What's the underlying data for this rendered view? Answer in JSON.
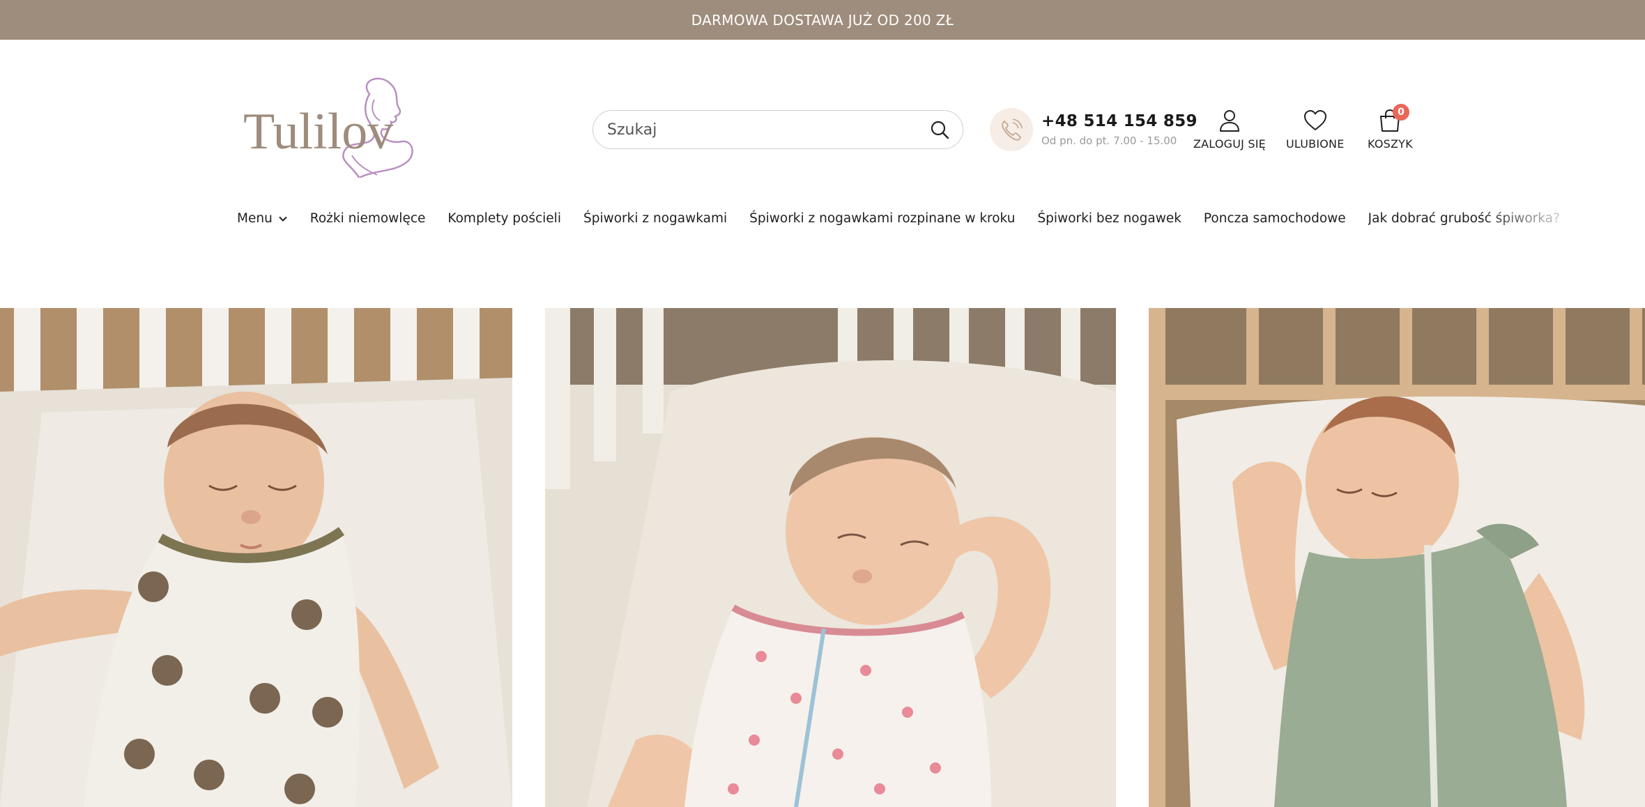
{
  "promo": {
    "text": "DARMOWA DOSTAWA JUŻ OD 200 ZŁ"
  },
  "brand": {
    "name": "Tulilov",
    "logo_color": "#9e8c7c",
    "accent_color": "#b98fc1"
  },
  "search": {
    "placeholder": "Szukaj",
    "value": ""
  },
  "contact": {
    "phone": "+48 514 154 859",
    "hours": "Od pn. do pt. 7.00 - 15.00"
  },
  "actions": {
    "login_label": "ZALOGUJ SIĘ",
    "favorites_label": "ULUBIONE",
    "cart_label": "KOSZYK",
    "cart_count": "0"
  },
  "nav": {
    "items": [
      {
        "label": "Menu"
      },
      {
        "label": "Rożki niemowlęce"
      },
      {
        "label": "Komplety pościeli"
      },
      {
        "label": "Śpiworki z nogawkami"
      },
      {
        "label": "Śpiworki z nogawkami rozpinane w kroku"
      },
      {
        "label": "Śpiworki bez nogawek"
      },
      {
        "label": "Poncza samochodowe"
      },
      {
        "label": "Jak dobrać grubość śpiworka?"
      }
    ]
  },
  "products": [
    {
      "image": "baby-sleeping-bag-teddy-bear-print",
      "color": "#eae5da"
    },
    {
      "image": "baby-sleeping-bag-pink-hearts-print",
      "color": "#f3ece6"
    },
    {
      "image": "baby-sleeping-bag-sage-green",
      "color": "#9aac94"
    }
  ],
  "colors": {
    "promo_bg": "#9e8c7c",
    "badge": "#e8675a",
    "phone_icon_bg": "#f5ede6"
  }
}
